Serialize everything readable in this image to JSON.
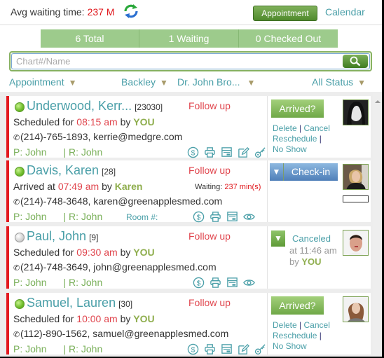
{
  "header": {
    "avg_label": "Avg waiting time:",
    "avg_value": "237 M",
    "refresh_icon": "refresh-icon",
    "appointment_button": "Appointment",
    "calendar_link": "Calendar"
  },
  "stats": {
    "total": "6 Total",
    "waiting": "1 Waiting",
    "checked_out": "0 Checked Out"
  },
  "search": {
    "placeholder": "Chart#/Name",
    "value": "",
    "button_icon": "search-icon"
  },
  "filters": {
    "type": "Appointment",
    "location": "Backley",
    "provider": "Dr. John Bro...",
    "status": "All Status"
  },
  "colors": {
    "accent_green": "#6fa847",
    "teal_link": "#4a9fa8",
    "alert_red": "#e0161b",
    "card_border": "#e3191f"
  },
  "patients": [
    {
      "name": "Underwood, Kerr...",
      "chart": "[23030]",
      "status_dot": "green",
      "follow": "Follow up",
      "line_prefix": "Scheduled for",
      "time": "08:15 am",
      "by_label": "by",
      "by": "YOU",
      "phone": "(214)-765-1893,",
      "email": "kerrie@medgre.com",
      "p": "P: John",
      "r": "| R: John",
      "icons": [
        "dollar-icon",
        "print-icon",
        "card-icon",
        "edit-icon",
        "key-icon"
      ],
      "action_button": "Arrived?",
      "actions": {
        "delete": "Delete",
        "cancel": "Cancel",
        "reschedule": "Reschedule",
        "no_show": "No Show",
        "sep": "|"
      }
    },
    {
      "name": "Davis, Karen",
      "chart": "[28]",
      "status_dot": "green",
      "follow": "Follow up",
      "line_prefix": "Arrived at",
      "time": "07:49 am",
      "by_label": "by",
      "by": "Karen",
      "waiting_label": "Waiting:",
      "waiting_value": "237 min(s)",
      "phone": "(214)-748-3648,",
      "email": "karen@greenapplesmed.com",
      "p": "P: John",
      "r": "| R: John",
      "room": "Room #:",
      "icons": [
        "dollar-icon",
        "print-icon",
        "card-icon",
        "eye-icon"
      ],
      "action_button": "Check-in"
    },
    {
      "name": "Paul, John",
      "chart": "[9]",
      "status_dot": "gray",
      "follow": "Follow up",
      "line_prefix": "Scheduled for",
      "time": "09:30 am",
      "by_label": "by",
      "by": "YOU",
      "phone": "(214)-748-3649,",
      "email": "john@greenapplesmed.com",
      "p": "P: John",
      "r": "| R: John",
      "icons": [
        "dollar-icon",
        "print-icon",
        "card-icon",
        "eye-icon"
      ],
      "status_label": "Canceled",
      "status_at": "at 11:46 am",
      "status_by_label": "by",
      "status_by": "YOU"
    },
    {
      "name": "Samuel, Lauren",
      "chart": "[30]",
      "status_dot": "green",
      "follow": "Follow up",
      "line_prefix": "Scheduled for",
      "time": "10:00 am",
      "by_label": "by",
      "by": "YOU",
      "phone": "(112)-890-1562,",
      "email": "samuel@greenapplesmed.com",
      "p": "P: John",
      "r": "| R: John",
      "icons": [
        "dollar-icon",
        "print-icon",
        "card-icon",
        "edit-icon",
        "key-icon"
      ],
      "action_button": "Arrived?",
      "actions": {
        "delete": "Delete",
        "cancel": "Cancel",
        "reschedule": "Reschedule",
        "no_show": "No Show",
        "sep": "|"
      }
    }
  ]
}
